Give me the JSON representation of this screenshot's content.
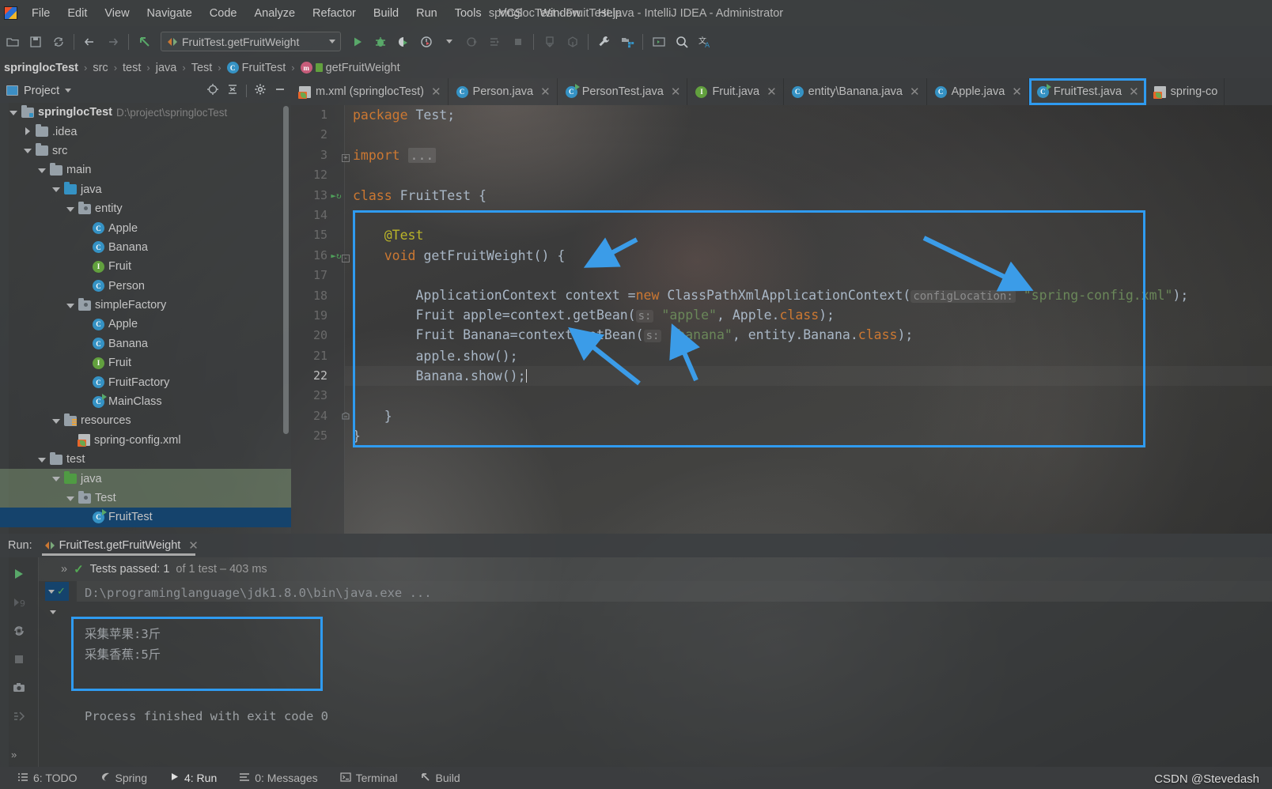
{
  "window": {
    "title": "springlocTest - FruitTest.java - IntelliJ IDEA - Administrator",
    "logo_icon": "intellij-logo-icon"
  },
  "menubar": {
    "items": [
      "File",
      "Edit",
      "View",
      "Navigate",
      "Code",
      "Analyze",
      "Refactor",
      "Build",
      "Run",
      "Tools",
      "VCS",
      "Window",
      "Help"
    ]
  },
  "toolbar": {
    "run_config_label": "FruitTest.getFruitWeight",
    "icons": [
      "open-icon",
      "save-icon",
      "sync-icon",
      "back-arrow-icon",
      "forward-arrow-icon",
      "undo-icon",
      "run-icon",
      "debug-icon",
      "run-coverage-icon",
      "profiler-icon",
      "dropdown-icon",
      "attach-icon",
      "step-icon",
      "stop-icon",
      "update-project-icon",
      "commit-icon",
      "settings-wrench-icon",
      "project-structure-icon",
      "terminal-icon",
      "search-icon",
      "translate-icon"
    ]
  },
  "breadcrumb": {
    "items": [
      {
        "label": "springlocTest",
        "icon": ""
      },
      {
        "label": "src",
        "icon": ""
      },
      {
        "label": "test",
        "icon": ""
      },
      {
        "label": "java",
        "icon": ""
      },
      {
        "label": "Test",
        "icon": ""
      },
      {
        "label": "FruitTest",
        "icon": "class-icon"
      },
      {
        "label": "getFruitWeight",
        "icon": "method-icon"
      }
    ]
  },
  "project_panel": {
    "title": "Project",
    "dropdown_icon": "chevron-down-icon",
    "action_icons": [
      "locate-icon",
      "collapse-all-icon",
      "settings-gear-icon",
      "hide-icon"
    ],
    "tree": [
      {
        "depth": 0,
        "label": "springlocTest",
        "suffix": "D:\\project\\springlocTest",
        "arrow": "down",
        "icon": "module-folder-icon",
        "bold": true,
        "selected": ""
      },
      {
        "depth": 1,
        "label": ".idea",
        "suffix": "",
        "arrow": "right",
        "icon": "folder-icon",
        "bold": false,
        "selected": ""
      },
      {
        "depth": 1,
        "label": "src",
        "suffix": "",
        "arrow": "down",
        "icon": "folder-icon",
        "bold": false,
        "selected": ""
      },
      {
        "depth": 2,
        "label": "main",
        "suffix": "",
        "arrow": "down",
        "icon": "folder-icon",
        "bold": false,
        "selected": ""
      },
      {
        "depth": 3,
        "label": "java",
        "suffix": "",
        "arrow": "down",
        "icon": "source-root-icon",
        "bold": false,
        "selected": ""
      },
      {
        "depth": 4,
        "label": "entity",
        "suffix": "",
        "arrow": "down",
        "icon": "package-icon",
        "bold": false,
        "selected": ""
      },
      {
        "depth": 5,
        "label": "Apple",
        "suffix": "",
        "arrow": "",
        "icon": "class-icon",
        "bold": false,
        "selected": ""
      },
      {
        "depth": 5,
        "label": "Banana",
        "suffix": "",
        "arrow": "",
        "icon": "class-icon",
        "bold": false,
        "selected": ""
      },
      {
        "depth": 5,
        "label": "Fruit",
        "suffix": "",
        "arrow": "",
        "icon": "interface-icon",
        "bold": false,
        "selected": ""
      },
      {
        "depth": 5,
        "label": "Person",
        "suffix": "",
        "arrow": "",
        "icon": "class-icon",
        "bold": false,
        "selected": ""
      },
      {
        "depth": 4,
        "label": "simpleFactory",
        "suffix": "",
        "arrow": "down",
        "icon": "package-icon",
        "bold": false,
        "selected": ""
      },
      {
        "depth": 5,
        "label": "Apple",
        "suffix": "",
        "arrow": "",
        "icon": "class-icon",
        "bold": false,
        "selected": ""
      },
      {
        "depth": 5,
        "label": "Banana",
        "suffix": "",
        "arrow": "",
        "icon": "class-icon",
        "bold": false,
        "selected": ""
      },
      {
        "depth": 5,
        "label": "Fruit",
        "suffix": "",
        "arrow": "",
        "icon": "interface-icon",
        "bold": false,
        "selected": ""
      },
      {
        "depth": 5,
        "label": "FruitFactory",
        "suffix": "",
        "arrow": "",
        "icon": "class-icon",
        "bold": false,
        "selected": ""
      },
      {
        "depth": 5,
        "label": "MainClass",
        "suffix": "",
        "arrow": "",
        "icon": "runnable-class-icon",
        "bold": false,
        "selected": ""
      },
      {
        "depth": 3,
        "label": "resources",
        "suffix": "",
        "arrow": "down",
        "icon": "resource-root-icon",
        "bold": false,
        "selected": ""
      },
      {
        "depth": 4,
        "label": "spring-config.xml",
        "suffix": "",
        "arrow": "",
        "icon": "spring-xml-icon",
        "bold": false,
        "selected": ""
      },
      {
        "depth": 2,
        "label": "test",
        "suffix": "",
        "arrow": "down",
        "icon": "folder-icon",
        "bold": false,
        "selected": ""
      },
      {
        "depth": 3,
        "label": "java",
        "suffix": "",
        "arrow": "down",
        "icon": "test-source-root-icon",
        "bold": false,
        "selected": "green"
      },
      {
        "depth": 4,
        "label": "Test",
        "suffix": "",
        "arrow": "down",
        "icon": "package-icon",
        "bold": false,
        "selected": "green"
      },
      {
        "depth": 5,
        "label": "FruitTest",
        "suffix": "",
        "arrow": "",
        "icon": "runnable-class-icon",
        "bold": false,
        "selected": "blue"
      }
    ]
  },
  "editor_tabs": [
    {
      "label": "m.xml (springlocTest)",
      "icon": "maven-xml-icon",
      "closable": true,
      "state": ""
    },
    {
      "label": "Person.java",
      "icon": "class-icon",
      "closable": true,
      "state": ""
    },
    {
      "label": "PersonTest.java",
      "icon": "runnable-class-icon",
      "closable": true,
      "state": ""
    },
    {
      "label": "Fruit.java",
      "icon": "interface-icon",
      "closable": true,
      "state": ""
    },
    {
      "label": "entity\\Banana.java",
      "icon": "class-icon",
      "closable": true,
      "state": ""
    },
    {
      "label": "Apple.java",
      "icon": "class-icon",
      "closable": true,
      "state": ""
    },
    {
      "label": "FruitTest.java",
      "icon": "runnable-class-icon",
      "closable": true,
      "state": "active-highlighted"
    },
    {
      "label": "spring-co",
      "icon": "spring-xml-icon",
      "closable": false,
      "state": ""
    }
  ],
  "code": {
    "lines": [
      {
        "num": "1",
        "gutter": "",
        "fold": "",
        "current": false,
        "tokens": [
          {
            "t": "kw",
            "v": "package"
          },
          {
            "t": "plain",
            "v": " "
          },
          {
            "t": "ident",
            "v": "Test"
          },
          {
            "t": "plain",
            "v": ";"
          }
        ]
      },
      {
        "num": "2",
        "gutter": "",
        "fold": "",
        "current": false,
        "tokens": []
      },
      {
        "num": "3",
        "gutter": "",
        "fold": "+",
        "current": false,
        "tokens": [
          {
            "t": "kw",
            "v": "import"
          },
          {
            "t": "plain",
            "v": " "
          },
          {
            "t": "fold",
            "v": "..."
          }
        ]
      },
      {
        "num": "12",
        "gutter": "",
        "fold": "",
        "current": false,
        "tokens": []
      },
      {
        "num": "13",
        "gutter": "run",
        "fold": "",
        "current": false,
        "tokens": [
          {
            "t": "kw",
            "v": "class"
          },
          {
            "t": "plain",
            "v": " "
          },
          {
            "t": "ident",
            "v": "FruitTest"
          },
          {
            "t": "plain",
            "v": " {"
          }
        ]
      },
      {
        "num": "14",
        "gutter": "",
        "fold": "",
        "current": false,
        "tokens": []
      },
      {
        "num": "15",
        "gutter": "",
        "fold": "",
        "current": false,
        "tokens": [
          {
            "t": "plain",
            "v": "    "
          },
          {
            "t": "ann",
            "v": "@Test"
          }
        ]
      },
      {
        "num": "16",
        "gutter": "run",
        "fold": "-",
        "current": false,
        "tokens": [
          {
            "t": "plain",
            "v": "    "
          },
          {
            "t": "kw",
            "v": "void"
          },
          {
            "t": "plain",
            "v": " "
          },
          {
            "t": "ident",
            "v": "getFruitWeight"
          },
          {
            "t": "plain",
            "v": "() {"
          }
        ]
      },
      {
        "num": "17",
        "gutter": "",
        "fold": "",
        "current": false,
        "tokens": []
      },
      {
        "num": "18",
        "gutter": "",
        "fold": "",
        "current": false,
        "tokens": [
          {
            "t": "plain",
            "v": "        ApplicationContext context ="
          },
          {
            "t": "kw",
            "v": "new"
          },
          {
            "t": "plain",
            "v": " ClassPathXmlApplicationContext("
          },
          {
            "t": "hint",
            "v": "configLocation:"
          },
          {
            "t": "plain",
            "v": " "
          },
          {
            "t": "str",
            "v": "\"spring-config.xml\""
          },
          {
            "t": "plain",
            "v": ");"
          }
        ]
      },
      {
        "num": "19",
        "gutter": "",
        "fold": "",
        "current": false,
        "tokens": [
          {
            "t": "plain",
            "v": "        Fruit apple=context.getBean("
          },
          {
            "t": "hint",
            "v": "s:"
          },
          {
            "t": "plain",
            "v": " "
          },
          {
            "t": "str",
            "v": "\"apple\""
          },
          {
            "t": "plain",
            "v": ", Apple."
          },
          {
            "t": "kw",
            "v": "class"
          },
          {
            "t": "plain",
            "v": ");"
          }
        ]
      },
      {
        "num": "20",
        "gutter": "",
        "fold": "",
        "current": false,
        "tokens": [
          {
            "t": "plain",
            "v": "        Fruit Banana=context.getBean("
          },
          {
            "t": "hint",
            "v": "s:"
          },
          {
            "t": "plain",
            "v": " "
          },
          {
            "t": "str",
            "v": "\"banana\""
          },
          {
            "t": "plain",
            "v": ", entity.Banana."
          },
          {
            "t": "kw",
            "v": "class"
          },
          {
            "t": "plain",
            "v": ");"
          }
        ]
      },
      {
        "num": "21",
        "gutter": "",
        "fold": "",
        "current": false,
        "tokens": [
          {
            "t": "plain",
            "v": "        apple.show();"
          }
        ]
      },
      {
        "num": "22",
        "gutter": "",
        "fold": "",
        "current": true,
        "tokens": [
          {
            "t": "plain",
            "v": "        Banana.show();"
          },
          {
            "t": "caret",
            "v": ""
          }
        ]
      },
      {
        "num": "23",
        "gutter": "",
        "fold": "",
        "current": false,
        "tokens": []
      },
      {
        "num": "24",
        "gutter": "",
        "fold": "b",
        "current": false,
        "tokens": [
          {
            "t": "plain",
            "v": "    }"
          }
        ]
      },
      {
        "num": "25",
        "gutter": "",
        "fold": "",
        "current": false,
        "tokens": [
          {
            "t": "plain",
            "v": "}"
          }
        ]
      }
    ]
  },
  "run_panel": {
    "run_label": "Run:",
    "config_tab": "FruitTest.getFruitWeight",
    "close_icon": "close-icon",
    "side_icons": [
      "rerun-icon",
      "rerun-failed-icon",
      "toggle-auto-test-icon",
      "stop-icon",
      "screenshot-icon",
      "dump-threads-icon"
    ],
    "test_status": {
      "expand_icon": "expand-icon",
      "check_icon": "check-icon",
      "text": "Tests passed: 1",
      "detail": "of 1 test – 403 ms"
    },
    "console": {
      "command_line": "D:\\programinglanguage\\jdk1.8.0\\bin\\java.exe ...",
      "output_lines": [
        "采集苹果:3斤",
        "采集香蕉:5斤"
      ],
      "exit_line": "Process finished with exit code 0"
    }
  },
  "statusbar": {
    "items": [
      {
        "label": "6: TODO",
        "icon": "todo-icon",
        "active": false
      },
      {
        "label": "Spring",
        "icon": "spring-icon",
        "active": false
      },
      {
        "label": "4: Run",
        "icon": "run-icon",
        "active": true
      },
      {
        "label": "0: Messages",
        "icon": "messages-icon",
        "active": false
      },
      {
        "label": "Terminal",
        "icon": "terminal-icon",
        "active": false
      },
      {
        "label": "Build",
        "icon": "build-icon",
        "active": false
      }
    ]
  },
  "watermark": "CSDN @Stevedash",
  "colors": {
    "accent_highlight": "#2f9bf0",
    "keyword": "#cc7832",
    "string": "#6a8759",
    "annotation": "#bbb529",
    "identifier": "#a9b7c6",
    "selection_blue": "#15436c",
    "selection_green": "#86a079",
    "panel_bg": "#3c3f41"
  }
}
